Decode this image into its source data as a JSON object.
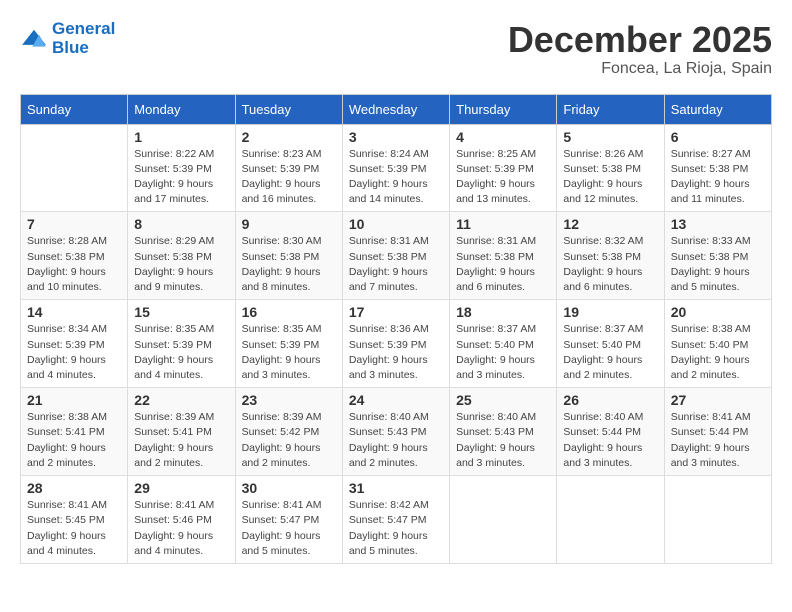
{
  "logo": {
    "line1": "General",
    "line2": "Blue"
  },
  "title": "December 2025",
  "subtitle": "Foncea, La Rioja, Spain",
  "days_of_week": [
    "Sunday",
    "Monday",
    "Tuesday",
    "Wednesday",
    "Thursday",
    "Friday",
    "Saturday"
  ],
  "weeks": [
    [
      {
        "day": "",
        "info": ""
      },
      {
        "day": "1",
        "info": "Sunrise: 8:22 AM\nSunset: 5:39 PM\nDaylight: 9 hours\nand 17 minutes."
      },
      {
        "day": "2",
        "info": "Sunrise: 8:23 AM\nSunset: 5:39 PM\nDaylight: 9 hours\nand 16 minutes."
      },
      {
        "day": "3",
        "info": "Sunrise: 8:24 AM\nSunset: 5:39 PM\nDaylight: 9 hours\nand 14 minutes."
      },
      {
        "day": "4",
        "info": "Sunrise: 8:25 AM\nSunset: 5:39 PM\nDaylight: 9 hours\nand 13 minutes."
      },
      {
        "day": "5",
        "info": "Sunrise: 8:26 AM\nSunset: 5:38 PM\nDaylight: 9 hours\nand 12 minutes."
      },
      {
        "day": "6",
        "info": "Sunrise: 8:27 AM\nSunset: 5:38 PM\nDaylight: 9 hours\nand 11 minutes."
      }
    ],
    [
      {
        "day": "7",
        "info": "Sunrise: 8:28 AM\nSunset: 5:38 PM\nDaylight: 9 hours\nand 10 minutes."
      },
      {
        "day": "8",
        "info": "Sunrise: 8:29 AM\nSunset: 5:38 PM\nDaylight: 9 hours\nand 9 minutes."
      },
      {
        "day": "9",
        "info": "Sunrise: 8:30 AM\nSunset: 5:38 PM\nDaylight: 9 hours\nand 8 minutes."
      },
      {
        "day": "10",
        "info": "Sunrise: 8:31 AM\nSunset: 5:38 PM\nDaylight: 9 hours\nand 7 minutes."
      },
      {
        "day": "11",
        "info": "Sunrise: 8:31 AM\nSunset: 5:38 PM\nDaylight: 9 hours\nand 6 minutes."
      },
      {
        "day": "12",
        "info": "Sunrise: 8:32 AM\nSunset: 5:38 PM\nDaylight: 9 hours\nand 6 minutes."
      },
      {
        "day": "13",
        "info": "Sunrise: 8:33 AM\nSunset: 5:38 PM\nDaylight: 9 hours\nand 5 minutes."
      }
    ],
    [
      {
        "day": "14",
        "info": "Sunrise: 8:34 AM\nSunset: 5:39 PM\nDaylight: 9 hours\nand 4 minutes."
      },
      {
        "day": "15",
        "info": "Sunrise: 8:35 AM\nSunset: 5:39 PM\nDaylight: 9 hours\nand 4 minutes."
      },
      {
        "day": "16",
        "info": "Sunrise: 8:35 AM\nSunset: 5:39 PM\nDaylight: 9 hours\nand 3 minutes."
      },
      {
        "day": "17",
        "info": "Sunrise: 8:36 AM\nSunset: 5:39 PM\nDaylight: 9 hours\nand 3 minutes."
      },
      {
        "day": "18",
        "info": "Sunrise: 8:37 AM\nSunset: 5:40 PM\nDaylight: 9 hours\nand 3 minutes."
      },
      {
        "day": "19",
        "info": "Sunrise: 8:37 AM\nSunset: 5:40 PM\nDaylight: 9 hours\nand 2 minutes."
      },
      {
        "day": "20",
        "info": "Sunrise: 8:38 AM\nSunset: 5:40 PM\nDaylight: 9 hours\nand 2 minutes."
      }
    ],
    [
      {
        "day": "21",
        "info": "Sunrise: 8:38 AM\nSunset: 5:41 PM\nDaylight: 9 hours\nand 2 minutes."
      },
      {
        "day": "22",
        "info": "Sunrise: 8:39 AM\nSunset: 5:41 PM\nDaylight: 9 hours\nand 2 minutes."
      },
      {
        "day": "23",
        "info": "Sunrise: 8:39 AM\nSunset: 5:42 PM\nDaylight: 9 hours\nand 2 minutes."
      },
      {
        "day": "24",
        "info": "Sunrise: 8:40 AM\nSunset: 5:43 PM\nDaylight: 9 hours\nand 2 minutes."
      },
      {
        "day": "25",
        "info": "Sunrise: 8:40 AM\nSunset: 5:43 PM\nDaylight: 9 hours\nand 3 minutes."
      },
      {
        "day": "26",
        "info": "Sunrise: 8:40 AM\nSunset: 5:44 PM\nDaylight: 9 hours\nand 3 minutes."
      },
      {
        "day": "27",
        "info": "Sunrise: 8:41 AM\nSunset: 5:44 PM\nDaylight: 9 hours\nand 3 minutes."
      }
    ],
    [
      {
        "day": "28",
        "info": "Sunrise: 8:41 AM\nSunset: 5:45 PM\nDaylight: 9 hours\nand 4 minutes."
      },
      {
        "day": "29",
        "info": "Sunrise: 8:41 AM\nSunset: 5:46 PM\nDaylight: 9 hours\nand 4 minutes."
      },
      {
        "day": "30",
        "info": "Sunrise: 8:41 AM\nSunset: 5:47 PM\nDaylight: 9 hours\nand 5 minutes."
      },
      {
        "day": "31",
        "info": "Sunrise: 8:42 AM\nSunset: 5:47 PM\nDaylight: 9 hours\nand 5 minutes."
      },
      {
        "day": "",
        "info": ""
      },
      {
        "day": "",
        "info": ""
      },
      {
        "day": "",
        "info": ""
      }
    ]
  ]
}
